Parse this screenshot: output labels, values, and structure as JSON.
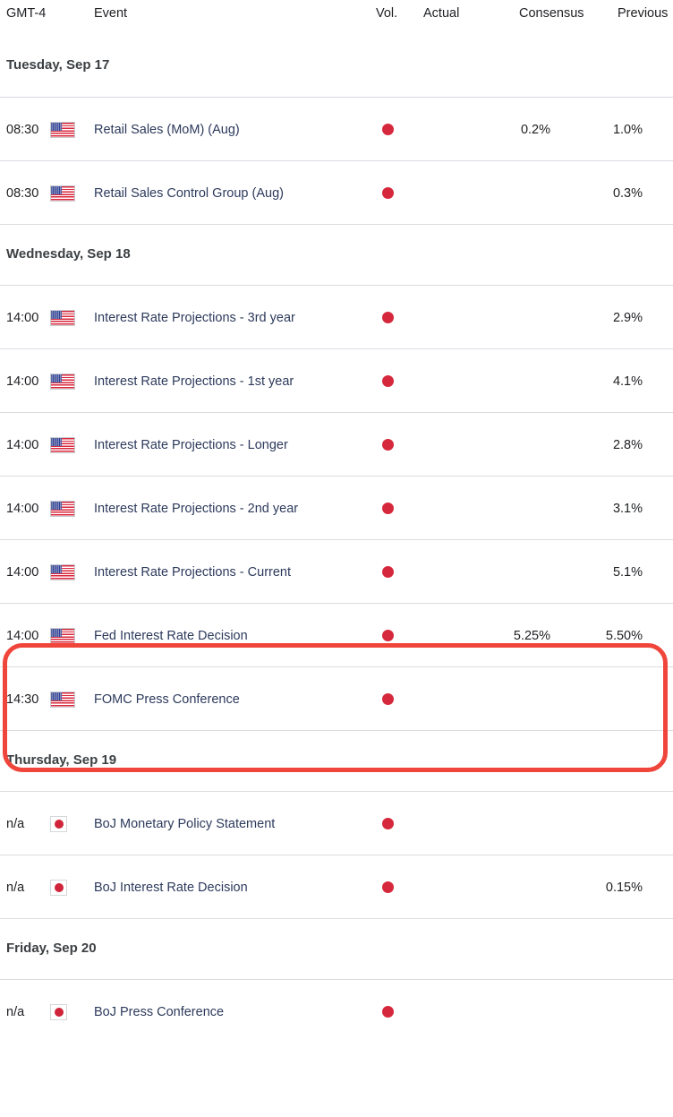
{
  "header": {
    "time_label": "GMT-4",
    "event_label": "Event",
    "vol_label": "Vol.",
    "actual_label": "Actual",
    "consensus_label": "Consensus",
    "previous_label": "Previous"
  },
  "colors": {
    "volatility_dot": "#d6283c",
    "annotation_highlight": "#f0453a",
    "event_link": "#2d3a5c",
    "row_divider": "#dadce0",
    "day_heading": "#3c4043"
  },
  "icons": {
    "flag_us": "us-flag-icon",
    "flag_jp": "japan-flag-icon",
    "volatility": "volatility-dot-icon"
  },
  "days": [
    {
      "label": "Tuesday, Sep 17",
      "rows": [
        {
          "time": "08:30",
          "flag": "us",
          "event": "Retail Sales (MoM) (Aug)",
          "volatility": "high",
          "actual": "",
          "consensus": "0.2%",
          "previous": "1.0%",
          "highlighted": false
        },
        {
          "time": "08:30",
          "flag": "us",
          "event": "Retail Sales Control Group (Aug)",
          "volatility": "high",
          "actual": "",
          "consensus": "",
          "previous": "0.3%",
          "highlighted": false
        }
      ]
    },
    {
      "label": "Wednesday, Sep 18",
      "rows": [
        {
          "time": "14:00",
          "flag": "us",
          "event": "Interest Rate Projections - 3rd year",
          "volatility": "high",
          "actual": "",
          "consensus": "",
          "previous": "2.9%",
          "highlighted": false
        },
        {
          "time": "14:00",
          "flag": "us",
          "event": "Interest Rate Projections - 1st year",
          "volatility": "high",
          "actual": "",
          "consensus": "",
          "previous": "4.1%",
          "highlighted": false
        },
        {
          "time": "14:00",
          "flag": "us",
          "event": "Interest Rate Projections - Longer",
          "volatility": "high",
          "actual": "",
          "consensus": "",
          "previous": "2.8%",
          "highlighted": false
        },
        {
          "time": "14:00",
          "flag": "us",
          "event": "Interest Rate Projections - 2nd year",
          "volatility": "high",
          "actual": "",
          "consensus": "",
          "previous": "3.1%",
          "highlighted": false
        },
        {
          "time": "14:00",
          "flag": "us",
          "event": "Interest Rate Projections - Current",
          "volatility": "high",
          "actual": "",
          "consensus": "",
          "previous": "5.1%",
          "highlighted": false
        },
        {
          "time": "14:00",
          "flag": "us",
          "event": "Fed Interest Rate Decision",
          "volatility": "high",
          "actual": "",
          "consensus": "5.25%",
          "previous": "5.50%",
          "highlighted": true
        },
        {
          "time": "14:30",
          "flag": "us",
          "event": "FOMC Press Conference",
          "volatility": "high",
          "actual": "",
          "consensus": "",
          "previous": "",
          "highlighted": true
        }
      ]
    },
    {
      "label": "Thursday, Sep 19",
      "rows": [
        {
          "time": "n/a",
          "flag": "jp",
          "event": "BoJ Monetary Policy Statement",
          "volatility": "high",
          "actual": "",
          "consensus": "",
          "previous": "",
          "highlighted": false
        },
        {
          "time": "n/a",
          "flag": "jp",
          "event": "BoJ Interest Rate Decision",
          "volatility": "high",
          "actual": "",
          "consensus": "",
          "previous": "0.15%",
          "highlighted": false
        }
      ]
    },
    {
      "label": "Friday, Sep 20",
      "rows": [
        {
          "time": "n/a",
          "flag": "jp",
          "event": "BoJ Press Conference",
          "volatility": "high",
          "actual": "",
          "consensus": "",
          "previous": "",
          "highlighted": false
        }
      ]
    }
  ]
}
